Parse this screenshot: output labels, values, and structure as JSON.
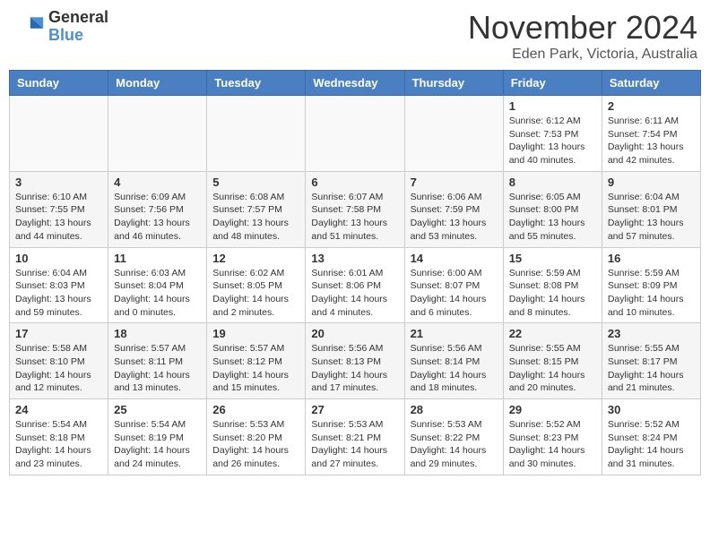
{
  "header": {
    "logo_general": "General",
    "logo_blue": "Blue",
    "month": "November 2024",
    "location": "Eden Park, Victoria, Australia"
  },
  "days_of_week": [
    "Sunday",
    "Monday",
    "Tuesday",
    "Wednesday",
    "Thursday",
    "Friday",
    "Saturday"
  ],
  "weeks": [
    [
      {
        "day": "",
        "info": ""
      },
      {
        "day": "",
        "info": ""
      },
      {
        "day": "",
        "info": ""
      },
      {
        "day": "",
        "info": ""
      },
      {
        "day": "",
        "info": ""
      },
      {
        "day": "1",
        "info": "Sunrise: 6:12 AM\nSunset: 7:53 PM\nDaylight: 13 hours\nand 40 minutes."
      },
      {
        "day": "2",
        "info": "Sunrise: 6:11 AM\nSunset: 7:54 PM\nDaylight: 13 hours\nand 42 minutes."
      }
    ],
    [
      {
        "day": "3",
        "info": "Sunrise: 6:10 AM\nSunset: 7:55 PM\nDaylight: 13 hours\nand 44 minutes."
      },
      {
        "day": "4",
        "info": "Sunrise: 6:09 AM\nSunset: 7:56 PM\nDaylight: 13 hours\nand 46 minutes."
      },
      {
        "day": "5",
        "info": "Sunrise: 6:08 AM\nSunset: 7:57 PM\nDaylight: 13 hours\nand 48 minutes."
      },
      {
        "day": "6",
        "info": "Sunrise: 6:07 AM\nSunset: 7:58 PM\nDaylight: 13 hours\nand 51 minutes."
      },
      {
        "day": "7",
        "info": "Sunrise: 6:06 AM\nSunset: 7:59 PM\nDaylight: 13 hours\nand 53 minutes."
      },
      {
        "day": "8",
        "info": "Sunrise: 6:05 AM\nSunset: 8:00 PM\nDaylight: 13 hours\nand 55 minutes."
      },
      {
        "day": "9",
        "info": "Sunrise: 6:04 AM\nSunset: 8:01 PM\nDaylight: 13 hours\nand 57 minutes."
      }
    ],
    [
      {
        "day": "10",
        "info": "Sunrise: 6:04 AM\nSunset: 8:03 PM\nDaylight: 13 hours\nand 59 minutes."
      },
      {
        "day": "11",
        "info": "Sunrise: 6:03 AM\nSunset: 8:04 PM\nDaylight: 14 hours\nand 0 minutes."
      },
      {
        "day": "12",
        "info": "Sunrise: 6:02 AM\nSunset: 8:05 PM\nDaylight: 14 hours\nand 2 minutes."
      },
      {
        "day": "13",
        "info": "Sunrise: 6:01 AM\nSunset: 8:06 PM\nDaylight: 14 hours\nand 4 minutes."
      },
      {
        "day": "14",
        "info": "Sunrise: 6:00 AM\nSunset: 8:07 PM\nDaylight: 14 hours\nand 6 minutes."
      },
      {
        "day": "15",
        "info": "Sunrise: 5:59 AM\nSunset: 8:08 PM\nDaylight: 14 hours\nand 8 minutes."
      },
      {
        "day": "16",
        "info": "Sunrise: 5:59 AM\nSunset: 8:09 PM\nDaylight: 14 hours\nand 10 minutes."
      }
    ],
    [
      {
        "day": "17",
        "info": "Sunrise: 5:58 AM\nSunset: 8:10 PM\nDaylight: 14 hours\nand 12 minutes."
      },
      {
        "day": "18",
        "info": "Sunrise: 5:57 AM\nSunset: 8:11 PM\nDaylight: 14 hours\nand 13 minutes."
      },
      {
        "day": "19",
        "info": "Sunrise: 5:57 AM\nSunset: 8:12 PM\nDaylight: 14 hours\nand 15 minutes."
      },
      {
        "day": "20",
        "info": "Sunrise: 5:56 AM\nSunset: 8:13 PM\nDaylight: 14 hours\nand 17 minutes."
      },
      {
        "day": "21",
        "info": "Sunrise: 5:56 AM\nSunset: 8:14 PM\nDaylight: 14 hours\nand 18 minutes."
      },
      {
        "day": "22",
        "info": "Sunrise: 5:55 AM\nSunset: 8:15 PM\nDaylight: 14 hours\nand 20 minutes."
      },
      {
        "day": "23",
        "info": "Sunrise: 5:55 AM\nSunset: 8:17 PM\nDaylight: 14 hours\nand 21 minutes."
      }
    ],
    [
      {
        "day": "24",
        "info": "Sunrise: 5:54 AM\nSunset: 8:18 PM\nDaylight: 14 hours\nand 23 minutes."
      },
      {
        "day": "25",
        "info": "Sunrise: 5:54 AM\nSunset: 8:19 PM\nDaylight: 14 hours\nand 24 minutes."
      },
      {
        "day": "26",
        "info": "Sunrise: 5:53 AM\nSunset: 8:20 PM\nDaylight: 14 hours\nand 26 minutes."
      },
      {
        "day": "27",
        "info": "Sunrise: 5:53 AM\nSunset: 8:21 PM\nDaylight: 14 hours\nand 27 minutes."
      },
      {
        "day": "28",
        "info": "Sunrise: 5:53 AM\nSunset: 8:22 PM\nDaylight: 14 hours\nand 29 minutes."
      },
      {
        "day": "29",
        "info": "Sunrise: 5:52 AM\nSunset: 8:23 PM\nDaylight: 14 hours\nand 30 minutes."
      },
      {
        "day": "30",
        "info": "Sunrise: 5:52 AM\nSunset: 8:24 PM\nDaylight: 14 hours\nand 31 minutes."
      }
    ]
  ]
}
